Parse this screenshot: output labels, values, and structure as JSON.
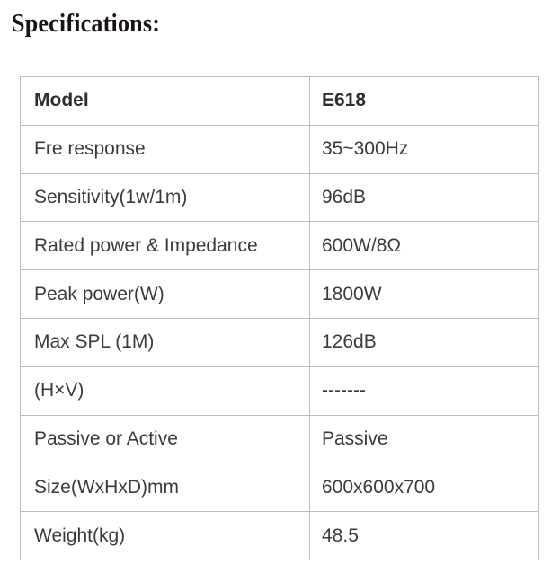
{
  "page": {
    "title": "Specifications:",
    "background_color": "#ffffff",
    "title_color": "#1a1412",
    "text_color": "#3b3b3b",
    "border_color": "#bcbcbc"
  },
  "spec_table": {
    "header": {
      "label": "Model",
      "value": "E618"
    },
    "rows": [
      {
        "label": "Fre response",
        "value": "35~300Hz"
      },
      {
        "label": "Sensitivity(1w/1m)",
        "value": "96dB"
      },
      {
        "label": "Rated power & Impedance",
        "value": "600W/8Ω"
      },
      {
        "label": "Peak power(W)",
        "value": "1800W"
      },
      {
        "label": "Max SPL (1M)",
        "value": "126dB"
      },
      {
        "label": "(H×V)",
        "value": "-------"
      },
      {
        "label": "Passive or Active",
        "value": "Passive"
      },
      {
        "label": "Size(WxHxD)mm",
        "value": "600x600x700"
      },
      {
        "label": "Weight(kg)",
        "value": "48.5"
      }
    ]
  }
}
